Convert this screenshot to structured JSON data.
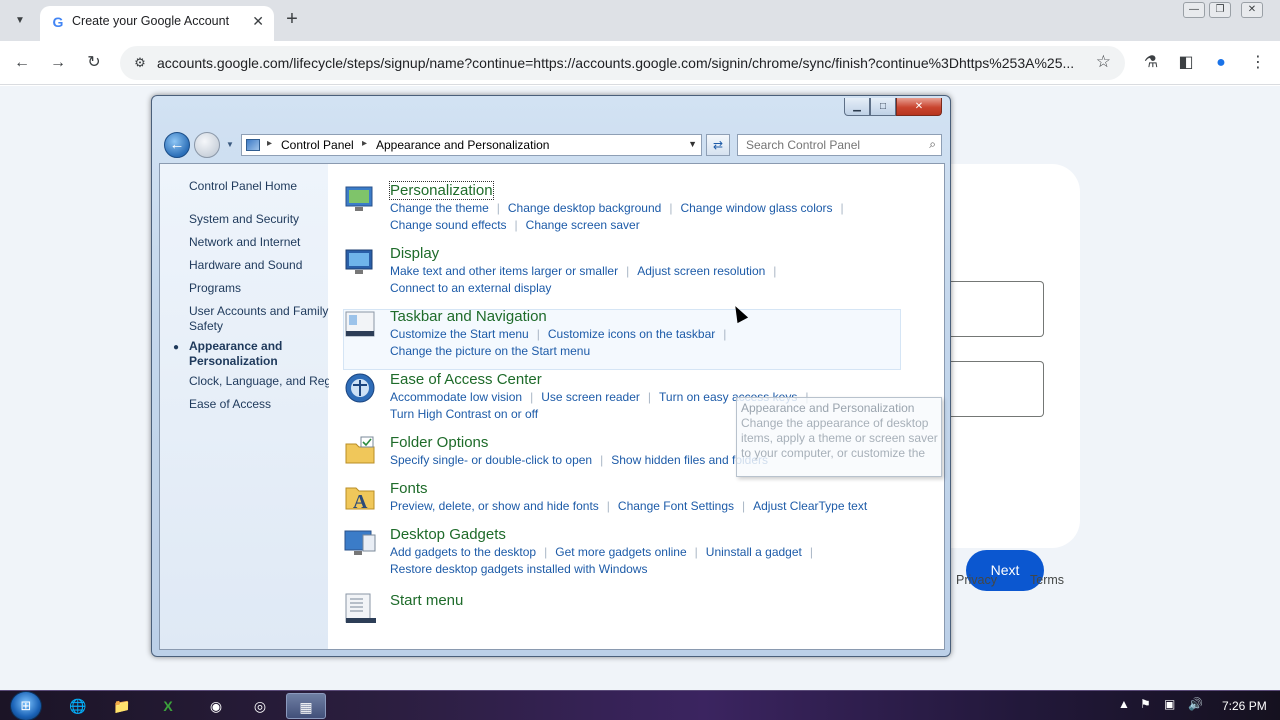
{
  "browser": {
    "tab_title": "Create your Google Account",
    "url": "accounts.google.com/lifecycle/steps/signup/name?continue=https://accounts.google.com/signin/chrome/sync/finish?continue%3Dhttps%253A%25..."
  },
  "google_page": {
    "next_label": "Next",
    "footer_links": [
      "Privacy",
      "Terms"
    ]
  },
  "control_panel": {
    "breadcrumb": [
      "Control Panel",
      "Appearance and Personalization"
    ],
    "search_placeholder": "Search Control Panel",
    "left_pane": [
      {
        "label": "Control Panel Home",
        "current": false
      },
      {
        "label": "System and Security",
        "current": false
      },
      {
        "label": "Network and Internet",
        "current": false
      },
      {
        "label": "Hardware and Sound",
        "current": false
      },
      {
        "label": "Programs",
        "current": false
      },
      {
        "label": "User Accounts and Family Safety",
        "current": false
      },
      {
        "label": "Appearance and Personalization",
        "current": true
      },
      {
        "label": "Clock, Language, and Reg",
        "current": false
      },
      {
        "label": "Ease of Access",
        "current": false
      }
    ],
    "categories": [
      {
        "title": "Personalization",
        "icon": "personalization-icon",
        "lines": [
          [
            "Change the theme",
            "Change desktop background",
            "Change window glass colors"
          ],
          [
            "Change sound effects",
            "Change screen saver"
          ]
        ]
      },
      {
        "title": "Display",
        "icon": "display-icon",
        "lines": [
          [
            "Make text and other items larger or smaller",
            "Adjust screen resolution"
          ],
          [
            "Connect to an external display"
          ]
        ]
      },
      {
        "title": "Taskbar and Navigation",
        "icon": "taskbar-icon",
        "lines": [
          [
            "Customize the Start menu",
            "Customize icons on the taskbar"
          ],
          [
            "Change the picture on the Start menu"
          ]
        ]
      },
      {
        "title": "Ease of Access Center",
        "icon": "ease-of-access-icon",
        "lines": [
          [
            "Accommodate low vision",
            "Use screen reader",
            "Turn on easy access keys"
          ],
          [
            "Turn High Contrast on or off"
          ]
        ]
      },
      {
        "title": "Folder Options",
        "icon": "folder-options-icon",
        "lines": [
          [
            "Specify single- or double-click to open",
            "Show hidden files and folders"
          ]
        ]
      },
      {
        "title": "Fonts",
        "icon": "fonts-icon",
        "lines": [
          [
            "Preview, delete, or show and hide fonts",
            "Change Font Settings",
            "Adjust ClearType text"
          ]
        ]
      },
      {
        "title": "Desktop Gadgets",
        "icon": "gadgets-icon",
        "lines": [
          [
            "Add gadgets to the desktop",
            "Get more gadgets online",
            "Uninstall a gadget"
          ],
          [
            "Restore desktop gadgets installed with Windows"
          ]
        ]
      },
      {
        "title": "Start menu",
        "icon": "start-menu-icon",
        "lines": []
      }
    ],
    "tooltip": {
      "title": "Appearance and Personalization",
      "body": "Change the appearance of desktop items, apply a theme or screen saver to your computer, or customize the"
    }
  },
  "taskbar": {
    "clock": "7:26 PM"
  },
  "colors": {
    "link": "#1d5ba8",
    "category_title": "#1e6b2a",
    "google_blue": "#0b57d0"
  }
}
